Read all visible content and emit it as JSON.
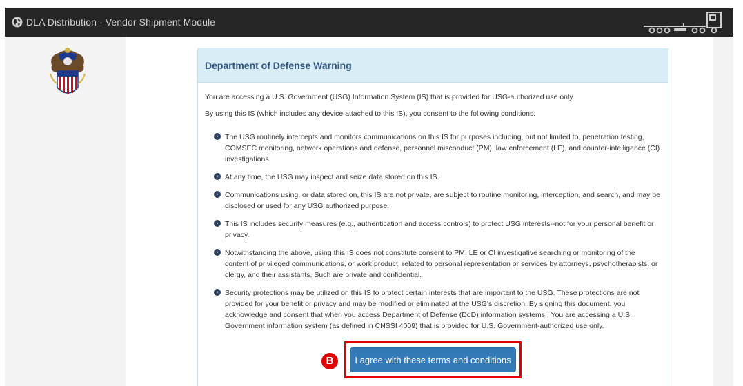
{
  "app": {
    "title": "DLA Distribution - Vendor Shipment Module"
  },
  "icons": {
    "globe": "globe-icon",
    "truck": "truck-logo-icon",
    "seal": "dla-seal-icon",
    "bullet": "chevron-circle-right-icon"
  },
  "colors": {
    "topbar": "#262626",
    "card_header": "#d9edf7",
    "card_title": "#31557c",
    "button": "#337ab7",
    "highlight": "#e00000"
  },
  "warning": {
    "title": "Department of Defense Warning",
    "intro": "You are accessing a U.S. Government (USG) Information System (IS) that is provided for USG-authorized use only.",
    "consent_lead": "By using this IS (which includes any device attached to this IS), you consent to the following conditions:",
    "conditions": [
      "The USG routinely intercepts and monitors communications on this IS for purposes including, but not limited to, penetration testing, COMSEC monitoring, network operations and defense, personnel misconduct (PM), law enforcement (LE), and counter-intelligence (CI) investigations.",
      "At any time, the USG may inspect and seize data stored on this IS.",
      "Communications using, or data stored on, this IS are not private, are subject to routine monitoring, interception, and search, and may be disclosed or used for any USG authorized purpose.",
      "This IS includes security measures (e.g., authentication and access controls) to protect USG interests--not for your personal benefit or privacy.",
      "Notwithstanding the above, using this IS does not constitute consent to PM, LE or CI investigative searching or monitoring of the content of privileged communications, or work product, related to personal representation or services by attorneys, psychotherapists, or clergy, and their assistants. Such are private and confidential.",
      "Security protections may be utilized on this IS to protect certain interests that are important to the USG. These protections are not provided for your benefit or privacy and may be modified or eliminated at the USG's discretion. By signing this document, you acknowledge and consent that when you access Department of Defense (DoD) information systems:, You are accessing a U.S. Government information system (as defined in CNSSI 4009) that is provided for U.S. Government-authorized use only."
    ],
    "agree_label": "I agree with these terms and conditions"
  },
  "callout": {
    "label": "B"
  }
}
